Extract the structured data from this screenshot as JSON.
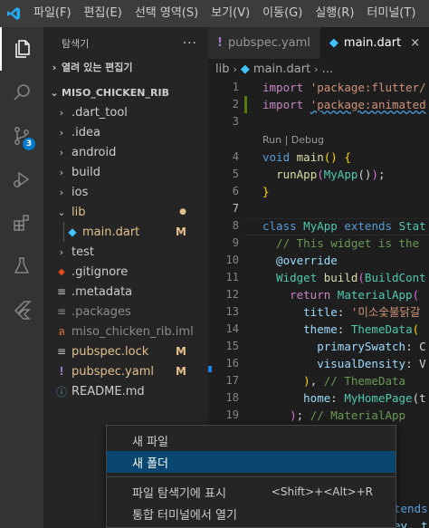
{
  "menu": [
    "파일(F)",
    "편집(E)",
    "선택 영역(S)",
    "보기(V)",
    "이동(G)",
    "실행(R)",
    "터미널(T)"
  ],
  "activity": {
    "scm_badge": "3"
  },
  "sidebar": {
    "title": "탐색기",
    "more": "···",
    "open_editors": "열려 있는 편집기",
    "project": "MISO_CHICKEN_RIB",
    "items": [
      {
        "label": ".dart_tool",
        "type": "folder",
        "open": false,
        "status": ""
      },
      {
        "label": ".idea",
        "type": "folder",
        "open": false,
        "status": ""
      },
      {
        "label": "android",
        "type": "folder",
        "open": false,
        "status": ""
      },
      {
        "label": "build",
        "type": "folder",
        "open": false,
        "status": ""
      },
      {
        "label": "ios",
        "type": "folder",
        "open": false,
        "status": ""
      },
      {
        "label": "lib",
        "type": "folder",
        "open": true,
        "status": "●"
      },
      {
        "label": "main.dart",
        "type": "dart",
        "status": "M"
      },
      {
        "label": "test",
        "type": "folder",
        "open": false,
        "status": ""
      },
      {
        "label": ".gitignore",
        "type": "git",
        "status": ""
      },
      {
        "label": ".metadata",
        "type": "file",
        "status": ""
      },
      {
        "label": ".packages",
        "type": "file",
        "status": ""
      },
      {
        "label": "miso_chicken_rib.iml",
        "type": "rss",
        "status": ""
      },
      {
        "label": "pubspec.lock",
        "type": "file",
        "status": "M"
      },
      {
        "label": "pubspec.yaml",
        "type": "yaml",
        "status": "M"
      },
      {
        "label": "README.md",
        "type": "info",
        "status": ""
      }
    ]
  },
  "tabs": [
    {
      "label": "pubspec.yaml",
      "icon": "!",
      "active": false
    },
    {
      "label": "main.dart",
      "icon": "dart",
      "active": true,
      "close": "×"
    }
  ],
  "breadcrumb": [
    "lib",
    "main.dart",
    "..."
  ],
  "editor": {
    "code_lens": "Run | Debug",
    "line_numbers": [
      "1",
      "2",
      "3",
      "4",
      "5",
      "6",
      "7",
      "8",
      "9",
      "10",
      "11",
      "12",
      "13",
      "14",
      "15",
      "16",
      "17",
      "18",
      "19"
    ],
    "lines": [
      "import 'package:flutter/",
      "import 'package:animated",
      "",
      "void main() {",
      "  runApp(MyApp());",
      "}",
      "",
      "class MyApp extends Stat",
      "  // This widget is the",
      "  @override",
      "  Widget build(BuildCont",
      "    return MaterialApp(",
      "      title: '미소숯불닭갈",
      "      theme: ThemeData(",
      "        primarySwatch: C",
      "        visualDensity: V",
      "      ), // ThemeData",
      "      home: MyHomePage(t",
      "    ); // MaterialApp"
    ],
    "peek_lines": [
      "tends",
      "ey, t"
    ]
  },
  "context_menu": [
    {
      "label": "새 파일",
      "shortcut": ""
    },
    {
      "label": "새 폴더",
      "shortcut": "",
      "selected": true
    },
    {
      "label": "파일 탐색기에 표시",
      "shortcut": "<Shift>+<Alt>+R"
    },
    {
      "label": "통합 터미널에서 열기",
      "shortcut": ""
    }
  ]
}
